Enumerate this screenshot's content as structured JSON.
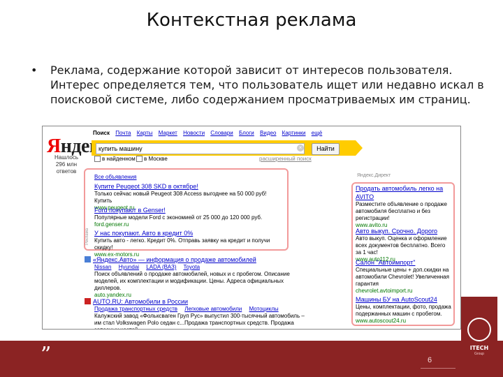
{
  "slide": {
    "title": "Контекстная реклама",
    "bullet_marker": "•",
    "bullet_text": "Реклама, содержание которой зависит от интересов пользователя. Интерес определяется тем, что пользователь ищет или недавно искал в поисковой системе, либо содержанием просматриваемых им страниц.",
    "page_number": "6",
    "quote_glyph": "”",
    "brand": "ITECH",
    "brand_sub": "Group"
  },
  "screenshot": {
    "logo_ya": "Я",
    "logo_rest": "ндекс",
    "logo_sub_line1": "Нашлось",
    "logo_sub_line2": "296 млн ответов",
    "nav": [
      "Поиск",
      "Почта",
      "Карты",
      "Маркет",
      "Новости",
      "Словари",
      "Блоги",
      "Видео",
      "Картинки",
      "ещё"
    ],
    "search_value": "купить машину",
    "clear_glyph": "×",
    "find_button": "Найти",
    "option_found": "в найденном",
    "option_moscow": "в Москве",
    "advanced_search": "расширенный поиск",
    "all_ads": "Все объявления",
    "ad_side_label": "Реклама",
    "left_ads": [
      {
        "title": "Купите Peugeot 308 SKD в октябре!",
        "text": "Только сейчас новый Peugeot 308 Access выгоднее на 50 000 руб! Купить",
        "url": "www.peugeot.ru"
      },
      {
        "title": "Ford покупают в Genser!",
        "text": "Популярные модели Ford с экономией от 25 000 до 120 000 руб.",
        "url": "ford.genser.ru"
      },
      {
        "title": "У нас покупают. Авто в кредит 0%",
        "text": "Купить авто - легко. Кредит 0%. Отправь заявку на кредит и получи скидку!",
        "url": "www.ex-motors.ru"
      }
    ],
    "organic": [
      {
        "title": "«Яндекс.Авто» — информация о продаже автомобилей",
        "sublinks": [
          "Nissan",
          "Hyundai",
          "LADA (ВАЗ)",
          "Toyota"
        ],
        "text": "Поиск объявлений о продаже автомобилей, новых и с пробегом. Описание моделей, их комплектации и модификации. Цены. Адреса официальных диллеров.",
        "url": "auto.yandex.ru"
      },
      {
        "title": "AUTO.RU: Автомобили в России",
        "sublinks": [
          "Продажа транспортных средств",
          "Легковые автомобили",
          "Мотоциклы"
        ],
        "text": "Калужский завод «Фольксваген Груп Рус» выпустил 300-тысячный автомобиль – им стал Volkswagen Polo седан с...Продажа транспортных средств. Продажа запасных частей.",
        "url": ""
      }
    ],
    "direct_label": "Яндекс.Директ",
    "right_ads": [
      {
        "title": "Продать автомобиль легко на AVITO",
        "text": "Разместите объявление о продаже автомобиля бесплатно и без регистрации!",
        "url": "www.avito.ru"
      },
      {
        "title": "Авто выкуп. Срочно. Дорого",
        "text": "Авто выкуп. Оценка и оформление всех документов бесплатно. Всего за 1 час!",
        "url": "www.auto112.ru"
      },
      {
        "title": "Салон \"Автоимпорт\"",
        "text": "Специальные цены + доп.скидки на автомобили Chevrolet! Увеличенная гарантия",
        "url": "chevrolet.avtoimport.ru"
      },
      {
        "title": "Машины БУ на AutoScout24",
        "text": "Цены, комплектации, фото, продажа подержанных машин с пробегом.",
        "url": "www.autoscout24.ru"
      }
    ]
  },
  "colors": {
    "link": "#0000cc",
    "url": "#007700",
    "search_bar": "#ffcc00",
    "ad_frame": "#f29a9a",
    "footer": "#8b2323"
  }
}
